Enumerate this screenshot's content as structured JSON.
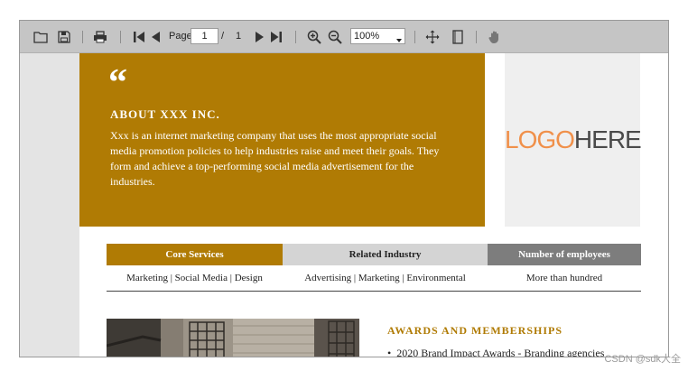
{
  "toolbar": {
    "page_label": "Page",
    "page_current": "1",
    "page_separator": "/",
    "page_total": "1",
    "zoom_value": "100%"
  },
  "document": {
    "about": {
      "quote_mark": "“",
      "title": "ABOUT XXX INC.",
      "body": "Xxx is an internet marketing company that uses the most appropriate social media promotion policies to help industries raise and meet their goals. They form and achieve a top-performing social media advertisement for the industries."
    },
    "logo": {
      "part1": "LOGO",
      "part2": "HERE"
    },
    "stats": [
      {
        "header": "Core Services",
        "value": "Marketing | Social Media | Design",
        "bg": "#b07b04",
        "fg": "#ffffff"
      },
      {
        "header": "Related Industry",
        "value": "Advertising | Marketing | Environmental",
        "bg": "#d4d4d4",
        "fg": "#222222"
      },
      {
        "header": "Number of employees",
        "value": "More than hundred",
        "bg": "#7d7d7d",
        "fg": "#ffffff"
      }
    ],
    "awards": {
      "title": "AWARDS AND MEMBERSHIPS",
      "items": [
        "2020 Brand Impact Awards - Branding agencies"
      ]
    }
  },
  "watermark": "CSDN @sdk大全",
  "colors": {
    "accent": "#b07b04",
    "toolbar": "#c5c5c5"
  }
}
